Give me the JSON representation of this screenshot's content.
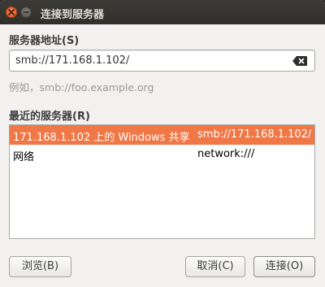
{
  "window": {
    "title": "连接到服务器",
    "close_icon": "close-icon",
    "minimize_icon": "minimize-icon",
    "close_color": "#e95420"
  },
  "address": {
    "label": "服务器地址(S)",
    "value": "smb://171.168.1.102/",
    "clear_icon": "backspace-clear-icon",
    "example": "例如，smb://foo.example.org"
  },
  "recent": {
    "label": "最近的服务器(R)",
    "items": [
      {
        "name": "171.168.1.102 上的 Windows 共享",
        "url": "smb://171.168.1.102/",
        "selected": true
      },
      {
        "name": "网络",
        "url": "network:///",
        "selected": false
      }
    ],
    "selection_color": "#f07746"
  },
  "buttons": {
    "browse": "浏览(B)",
    "cancel": "取消(C)",
    "connect": "连接(O)"
  }
}
